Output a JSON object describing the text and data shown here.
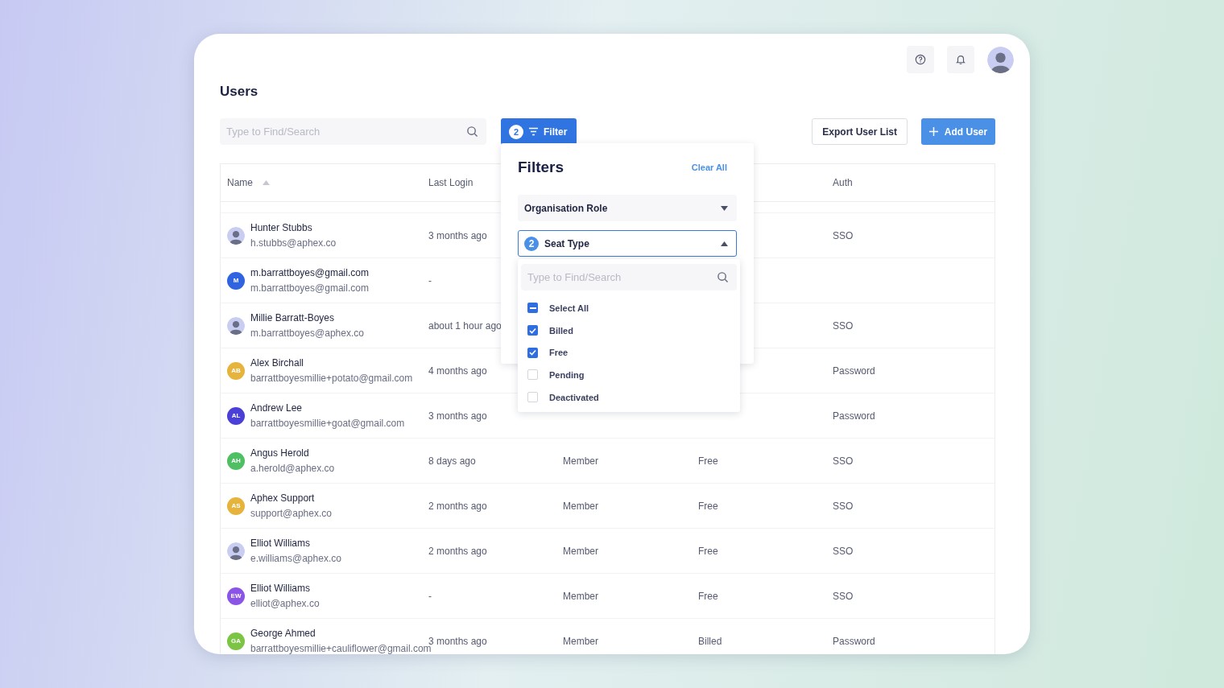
{
  "topbar": {
    "avatar": {
      "kind": "photo"
    }
  },
  "title": "Users",
  "search": {
    "placeholder": "Type to Find/Search"
  },
  "filter_button": {
    "count": "2",
    "label": "Filter"
  },
  "export_button": "Export User List",
  "add_button": "Add User",
  "header": {
    "name": "Name",
    "name_sort_ascending": true,
    "last_login": "Last Login",
    "auth": "Auth"
  },
  "rows": [
    {
      "avatar": {
        "kind": "photo"
      },
      "name": "Hunter Stubbs",
      "email": "h.stubbs@aphex.co",
      "last_login": "3 months ago",
      "auth": "SSO"
    },
    {
      "avatar": {
        "kind": "initials",
        "initials": "M",
        "color": "#2f63e0"
      },
      "name": "m.barrattboyes@gmail.com",
      "email": "m.barrattboyes@gmail.com",
      "last_login": "-"
    },
    {
      "avatar": {
        "kind": "photo"
      },
      "name": "Millie Barratt-Boyes",
      "email": "m.barrattboyes@aphex.co",
      "last_login": "about 1 hour ago",
      "auth": "SSO"
    },
    {
      "avatar": {
        "kind": "initials",
        "initials": "AB",
        "color": "#e6b43c"
      },
      "name": "Alex Birchall",
      "email": "barrattboyesmillie+potato@gmail.com",
      "last_login": "4 months ago",
      "auth": "Password"
    },
    {
      "avatar": {
        "kind": "initials",
        "initials": "AL",
        "color": "#4a3fd6"
      },
      "name": "Andrew Lee",
      "email": "barrattboyesmillie+goat@gmail.com",
      "last_login": "3 months ago",
      "auth": "Password"
    },
    {
      "avatar": {
        "kind": "initials",
        "initials": "AH",
        "color": "#4fbf64"
      },
      "name": "Angus Herold",
      "email": "a.herold@aphex.co",
      "last_login": "8 days ago",
      "role": "Member",
      "seat": "Free",
      "auth": "SSO"
    },
    {
      "avatar": {
        "kind": "initials",
        "initials": "AS",
        "color": "#e6b43c"
      },
      "name": "Aphex Support",
      "email": "support@aphex.co",
      "last_login": "2 months ago",
      "role": "Member",
      "seat": "Free",
      "auth": "SSO"
    },
    {
      "avatar": {
        "kind": "photo"
      },
      "name": "Elliot Williams",
      "email": "e.williams@aphex.co",
      "last_login": "2 months ago",
      "role": "Member",
      "seat": "Free",
      "auth": "SSO"
    },
    {
      "avatar": {
        "kind": "initials",
        "initials": "EW",
        "color": "#8a55e6"
      },
      "name": "Elliot Williams",
      "email": "elliot@aphex.co",
      "last_login": "-",
      "role": "Member",
      "seat": "Free",
      "auth": "SSO"
    },
    {
      "avatar": {
        "kind": "initials",
        "initials": "GA",
        "color": "#7cc444"
      },
      "name": "George Ahmed",
      "email": "barrattboyesmillie+cauliflower@gmail.com",
      "last_login": "3 months ago",
      "role": "Member",
      "seat": "Billed",
      "auth": "Password"
    }
  ],
  "filters": {
    "title": "Filters",
    "clear": "Clear All",
    "groups": [
      {
        "label": "Organisation Role",
        "expanded": false
      },
      {
        "label": "Seat Type",
        "count": "2",
        "expanded": true
      }
    ],
    "list": {
      "placeholder": "Type to Find/Search",
      "select_all": {
        "label": "Select All",
        "mixed": true
      },
      "options": [
        {
          "label": "Billed",
          "checked": true
        },
        {
          "label": "Free",
          "checked": true
        },
        {
          "label": "Pending",
          "checked": false
        },
        {
          "label": "Deactivated",
          "checked": false
        }
      ]
    }
  }
}
